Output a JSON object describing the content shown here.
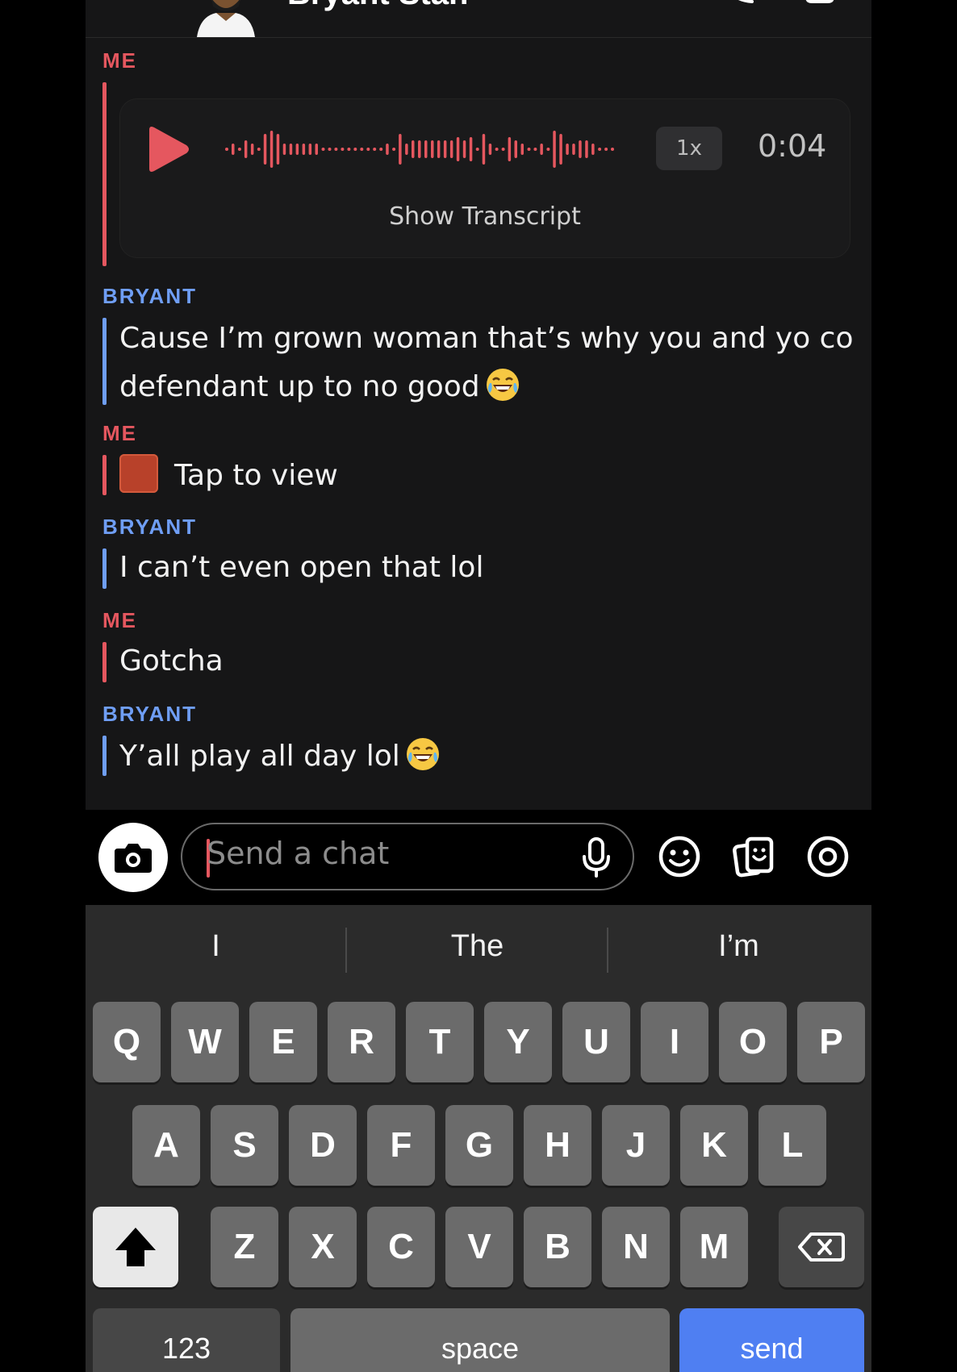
{
  "header": {
    "contact_name": "Bryant Stan"
  },
  "messages": [
    {
      "sender": "ME",
      "type": "voice",
      "speed": "1x",
      "duration": "0:04",
      "transcript_label": "Show Transcript"
    },
    {
      "sender": "BRYANT",
      "type": "text",
      "lines": [
        "Cause I’m grown woman that’s why you and yo co",
        "defendant up to no good"
      ],
      "emoji": "face-with-tears-of-joy"
    },
    {
      "sender": "ME",
      "type": "snap",
      "text": "Tap to view"
    },
    {
      "sender": "BRYANT",
      "type": "text",
      "lines": [
        "I can’t even open that lol"
      ]
    },
    {
      "sender": "ME",
      "type": "text",
      "lines": [
        "Gotcha"
      ]
    },
    {
      "sender": "BRYANT",
      "type": "text",
      "lines": [
        "Y’all play all day lol"
      ],
      "emoji": "face-with-tears-of-joy"
    }
  ],
  "composer": {
    "placeholder": "Send a chat",
    "icons": [
      "camera-icon",
      "microphone-icon",
      "smiley-icon",
      "stickers-icon",
      "location-icon"
    ]
  },
  "keyboard": {
    "suggestions": [
      "I",
      "The",
      "I’m"
    ],
    "row1": [
      "Q",
      "W",
      "E",
      "R",
      "T",
      "Y",
      "U",
      "I",
      "O",
      "P"
    ],
    "row2": [
      "A",
      "S",
      "D",
      "F",
      "G",
      "H",
      "J",
      "K",
      "L"
    ],
    "row3": [
      "Z",
      "X",
      "C",
      "V",
      "B",
      "N",
      "M"
    ],
    "numbers_key": "123",
    "space_key": "space",
    "send_key": "send"
  },
  "colors": {
    "me": "#e5575f",
    "bryant": "#6f9ef5",
    "send": "#4f7ff2"
  }
}
